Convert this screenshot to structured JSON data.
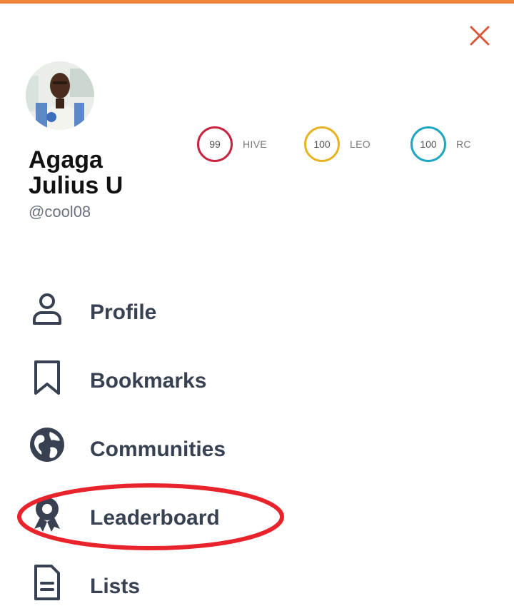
{
  "accent_color": "#f0843a",
  "close_icon": "close-icon",
  "profile": {
    "name_line1": "Agaga",
    "name_line2": "Julius U",
    "handle": "@cool08"
  },
  "meters": [
    {
      "value": "99",
      "label": "HIVE",
      "color": "#c8243f"
    },
    {
      "value": "100",
      "label": "LEO",
      "color": "#e6b422"
    },
    {
      "value": "100",
      "label": "RC",
      "color": "#1fa6c0"
    }
  ],
  "menu": [
    {
      "label": "Profile",
      "icon": "user-icon"
    },
    {
      "label": "Bookmarks",
      "icon": "bookmark-icon"
    },
    {
      "label": "Communities",
      "icon": "globe-icon"
    },
    {
      "label": "Leaderboard",
      "icon": "award-icon"
    },
    {
      "label": "Lists",
      "icon": "document-icon"
    }
  ],
  "annotation_color": "#e8232b"
}
